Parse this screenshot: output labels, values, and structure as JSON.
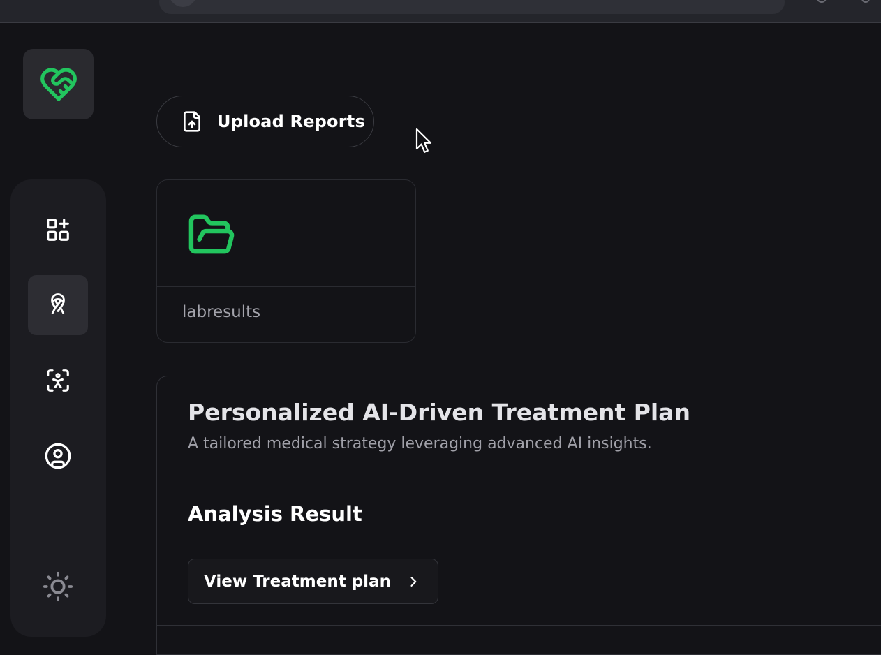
{
  "app": {
    "accent_color": "#22c55e",
    "background_color": "#131317"
  },
  "header": {
    "logo_icon": "heart-handshake-icon"
  },
  "sidebar": {
    "items": [
      {
        "icon": "dashboard-add-icon",
        "active": false
      },
      {
        "icon": "ribbon-icon",
        "active": true
      },
      {
        "icon": "user-scan-icon",
        "active": false
      },
      {
        "icon": "user-circle-icon",
        "active": false
      }
    ],
    "theme_toggle_icon": "sun-icon"
  },
  "upload": {
    "label": "Upload Reports",
    "icon": "file-upload-icon"
  },
  "folders": [
    {
      "name": "labresults",
      "icon": "folder-open-icon"
    }
  ],
  "plan": {
    "title": "Personalized AI-Driven Treatment Plan",
    "subtitle": "A tailored medical strategy leveraging advanced AI insights.",
    "analysis_title": "Analysis Result",
    "view_button_label": "View Treatment plan",
    "view_button_icon": "chevron-right-icon"
  }
}
